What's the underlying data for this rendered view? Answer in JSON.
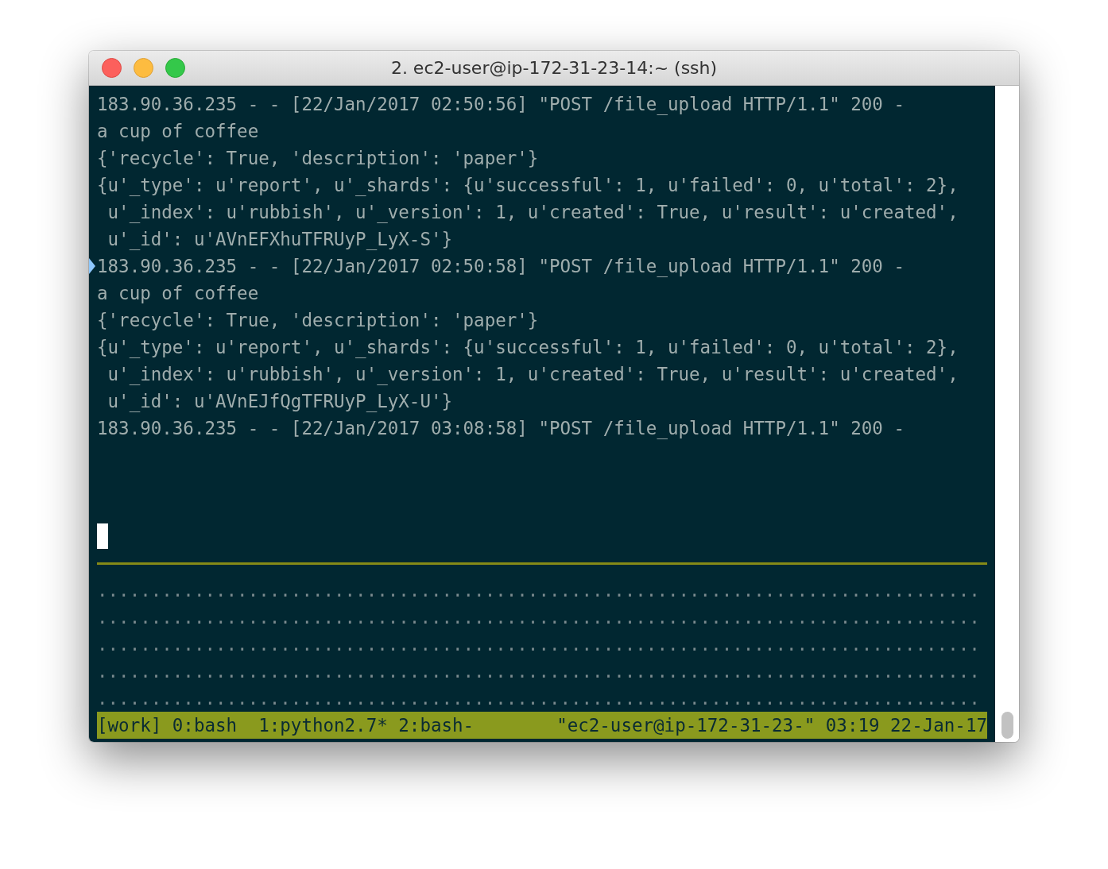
{
  "window": {
    "title": "2. ec2-user@ip-172-31-23-14:~ (ssh)"
  },
  "terminal": {
    "lines": [
      {
        "text": "183.90.36.235 - - [22/Jan/2017 02:50:56] \"POST /file_upload HTTP/1.1\" 200 -",
        "marked": false
      },
      {
        "text": "a cup of coffee",
        "marked": false
      },
      {
        "text": "{'recycle': True, 'description': 'paper'}",
        "marked": false
      },
      {
        "text": "{u'_type': u'report', u'_shards': {u'successful': 1, u'failed': 0, u'total': 2},",
        "marked": false
      },
      {
        "text": " u'_index': u'rubbish', u'_version': 1, u'created': True, u'result': u'created',",
        "marked": false
      },
      {
        "text": " u'_id': u'AVnEFXhuTFRUyP_LyX-S'}",
        "marked": false
      },
      {
        "text": "183.90.36.235 - - [22/Jan/2017 02:50:58] \"POST /file_upload HTTP/1.1\" 200 -",
        "marked": true
      },
      {
        "text": "a cup of coffee",
        "marked": false
      },
      {
        "text": "{'recycle': True, 'description': 'paper'}",
        "marked": false
      },
      {
        "text": "{u'_type': u'report', u'_shards': {u'successful': 1, u'failed': 0, u'total': 2},",
        "marked": false
      },
      {
        "text": " u'_index': u'rubbish', u'_version': 1, u'created': True, u'result': u'created',",
        "marked": false
      },
      {
        "text": " u'_id': u'AVnEJfQgTFRUyP_LyX-U'}",
        "marked": false
      },
      {
        "text": "183.90.36.235 - - [22/Jan/2017 03:08:58] \"POST /file_upload HTTP/1.1\" 200 -",
        "marked": false
      }
    ]
  },
  "lower_pane": {
    "rows": [
      "..................................................................................",
      "..................................................................................",
      "..................................................................................",
      "..................................................................................",
      ".................................................................................."
    ]
  },
  "status_bar": {
    "left": "[work] 0:bash  1:python2.7* 2:bash-",
    "right": "\"ec2-user@ip-172-31-23-\" 03:19 22-Jan-17"
  }
}
